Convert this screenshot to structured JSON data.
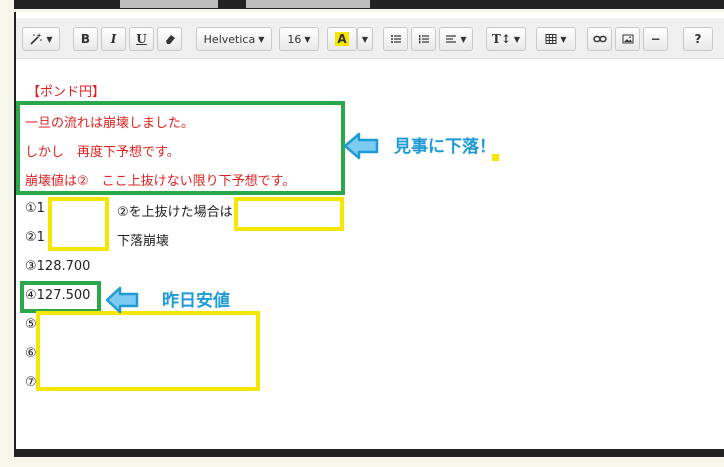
{
  "toolbar": {
    "font_family": "Helvetica",
    "font_size": "16",
    "bold": "B",
    "italic": "I",
    "underline": "U",
    "text_color": "A",
    "help": "?",
    "minus": "−",
    "text_height": "T↕"
  },
  "content": {
    "heading": "【ポンド円】",
    "red_lines": [
      "一旦の流れは崩壊しました。",
      "しかし　再度下予想です。",
      "崩壊値は②　ここ上抜けない限り下予想です。"
    ],
    "line1_prefix": "①1",
    "line1_mid": "②を上抜けた場合は",
    "line2_prefix": "②1",
    "line2_mid": "下落崩壊",
    "line3": "③128.700",
    "line4": "④127.500",
    "line5": "⑤",
    "line6": "⑥",
    "line7": "⑦"
  },
  "annotations": {
    "callout1": "見事に下落！",
    "callout2": "昨日安値"
  },
  "colors": {
    "green": "#2aa84a",
    "yellow": "#f5e600",
    "red_text": "#e02020",
    "annotation_blue": "#1e9bd7"
  }
}
